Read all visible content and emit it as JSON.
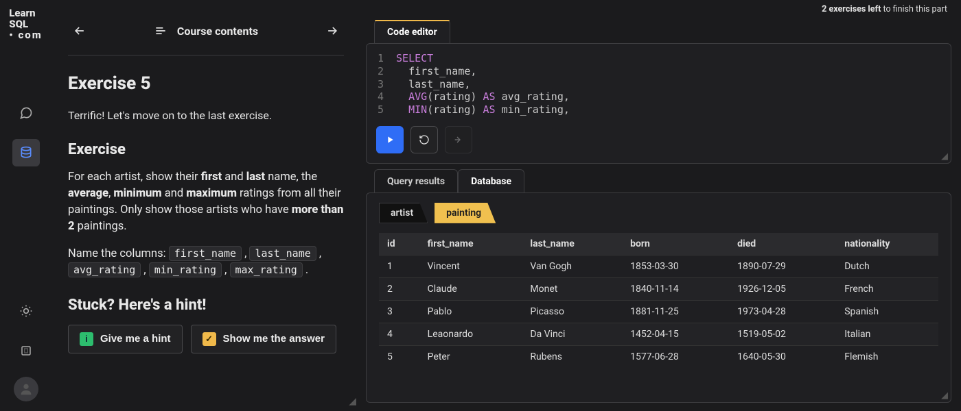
{
  "logo": {
    "l1": "Learn",
    "l2": "SQL",
    "l3": "• com"
  },
  "rail": {
    "chat": "chat",
    "db": "database",
    "theme": "theme",
    "fs": "fullscreen"
  },
  "crumb": {
    "title": "Course contents"
  },
  "exercise": {
    "heading": "Exercise 5",
    "intro": "Terrific! Let's move on to the last exercise.",
    "section": "Exercise",
    "p1_a": "For each artist, show their ",
    "p1_first": "first",
    "p1_and1": " and ",
    "p1_last": "last",
    "p1_b": " name, the ",
    "p1_avg": "average",
    "p1_c": ", ",
    "p1_min": "minimum",
    "p1_and2": " and ",
    "p1_max": "maximum",
    "p1_d": " ratings from all their paintings. Only show those artists who have ",
    "p1_more": "more than 2",
    "p1_e": " paintings.",
    "p2_a": "Name the columns: ",
    "chips": {
      "c1": "first_name",
      "c2": "last_name",
      "c3": "avg_rating",
      "c4": "min_rating",
      "c5": "max_rating"
    },
    "comma": " , ",
    "period": " .",
    "hint_h": "Stuck? Here's a hint!",
    "hint_btn": "Give me a hint",
    "answer_btn": "Show me the answer"
  },
  "notice": {
    "bold": "2 exercises left",
    "rest": " to finish this part"
  },
  "editor": {
    "tab": "Code editor",
    "lines": [
      "1",
      "2",
      "3",
      "4",
      "5"
    ],
    "tokens": {
      "select": "SELECT",
      "first": "first_name",
      "last": "last_name",
      "avg": "AVG",
      "min": "MIN",
      "as": "AS",
      "rating": "rating",
      "avg_r": "avg_rating",
      "min_r": "min_rating"
    }
  },
  "results": {
    "tab_q": "Query results",
    "tab_db": "Database",
    "sub_artist": "artist",
    "sub_painting": "painting",
    "cols": {
      "id": "id",
      "first": "first_name",
      "last": "last_name",
      "born": "born",
      "died": "died",
      "nat": "nationality"
    },
    "rows": [
      {
        "id": "1",
        "first": "Vincent",
        "last": "Van Gogh",
        "born": "1853-03-30",
        "died": "1890-07-29",
        "nat": "Dutch"
      },
      {
        "id": "2",
        "first": "Claude",
        "last": "Monet",
        "born": "1840-11-14",
        "died": "1926-12-05",
        "nat": "French"
      },
      {
        "id": "3",
        "first": "Pablo",
        "last": "Picasso",
        "born": "1881-11-25",
        "died": "1973-04-28",
        "nat": "Spanish"
      },
      {
        "id": "4",
        "first": "Leaonardo",
        "last": "Da Vinci",
        "born": "1452-04-15",
        "died": "1519-05-02",
        "nat": "Italian"
      },
      {
        "id": "5",
        "first": "Peter",
        "last": "Rubens",
        "born": "1577-06-28",
        "died": "1640-05-30",
        "nat": "Flemish"
      }
    ]
  }
}
